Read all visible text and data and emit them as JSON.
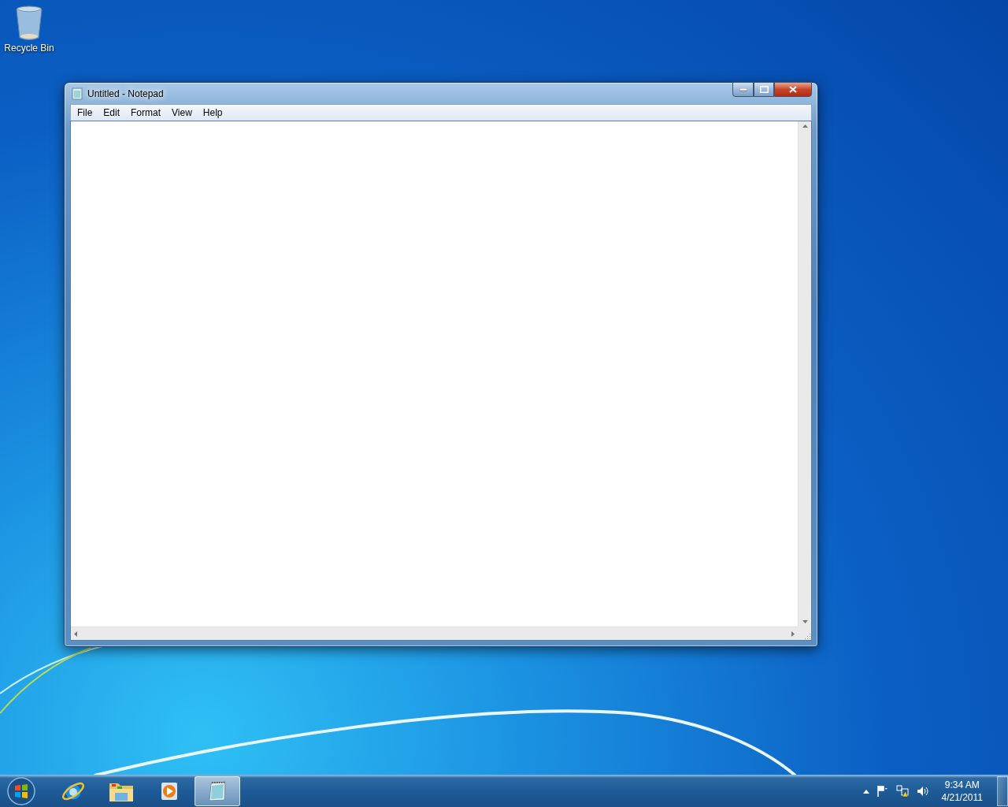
{
  "desktop": {
    "icons": [
      {
        "label": "Recycle Bin"
      }
    ]
  },
  "window": {
    "title": "Untitled - Notepad",
    "menu": [
      "File",
      "Edit",
      "Format",
      "View",
      "Help"
    ]
  },
  "taskbar": {
    "items": [
      {
        "kind": "start",
        "selected": false
      },
      {
        "kind": "browser",
        "selected": false
      },
      {
        "kind": "folder",
        "selected": false
      },
      {
        "kind": "media",
        "selected": false
      },
      {
        "kind": "notepad",
        "selected": true
      }
    ],
    "clock": {
      "time": "9:34 AM",
      "date": "4/21/2011"
    }
  }
}
